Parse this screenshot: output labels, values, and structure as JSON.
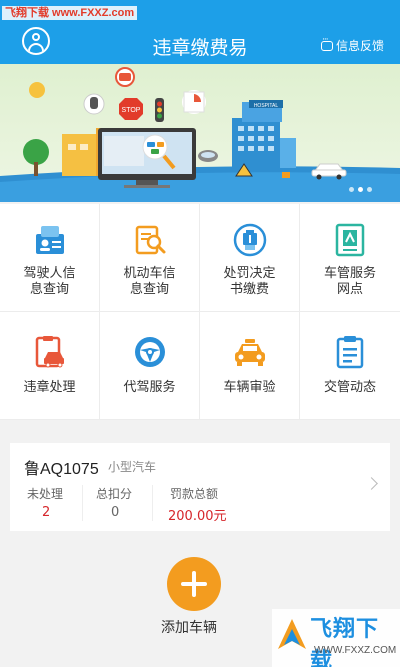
{
  "watermark_top": "飞翔下载 www.FXXZ.com",
  "header": {
    "title": "违章缴费易",
    "feedback_label": "信息反馈"
  },
  "banner": {
    "sign_text": "STOP",
    "building_label": "HOSPITAL",
    "slides": 3,
    "active_slide": 1
  },
  "grid": [
    {
      "label": "驾驶人信\n息查询",
      "icon": "driver-license-icon",
      "color": "#2a8fd8"
    },
    {
      "label": "机动车信\n息查询",
      "icon": "car-search-icon",
      "color": "#f39c1f"
    },
    {
      "label": "处罚决定\n书缴费",
      "icon": "payment-icon",
      "color": "#2a8fd8"
    },
    {
      "label": "车管服务\n网点",
      "icon": "service-point-icon",
      "color": "#2bb5a0"
    },
    {
      "label": "违章处理",
      "icon": "violation-icon",
      "color": "#e8573a"
    },
    {
      "label": "代驾服务",
      "icon": "steering-wheel-icon",
      "color": "#2a8fd8"
    },
    {
      "label": "车辆审验",
      "icon": "vehicle-inspection-icon",
      "color": "#f39c1f"
    },
    {
      "label": "交管动态",
      "icon": "clipboard-icon",
      "color": "#2a8fd8"
    }
  ],
  "vehicle": {
    "plate": "鲁AQ1075",
    "type": "小型汽车",
    "unprocessed_label": "未处理",
    "unprocessed_value": "2",
    "points_label": "总扣分",
    "points_value": "0",
    "fine_label": "罚款总额",
    "fine_value": "200.00元"
  },
  "add_vehicle_label": "添加车辆",
  "watermark_bottom": {
    "brand": "飞翔下载",
    "url": "WWW.FXXZ.COM"
  },
  "colors": {
    "header": "#1d9fe8",
    "accent_orange": "#f39c1f",
    "value_red": "#d6262b"
  }
}
